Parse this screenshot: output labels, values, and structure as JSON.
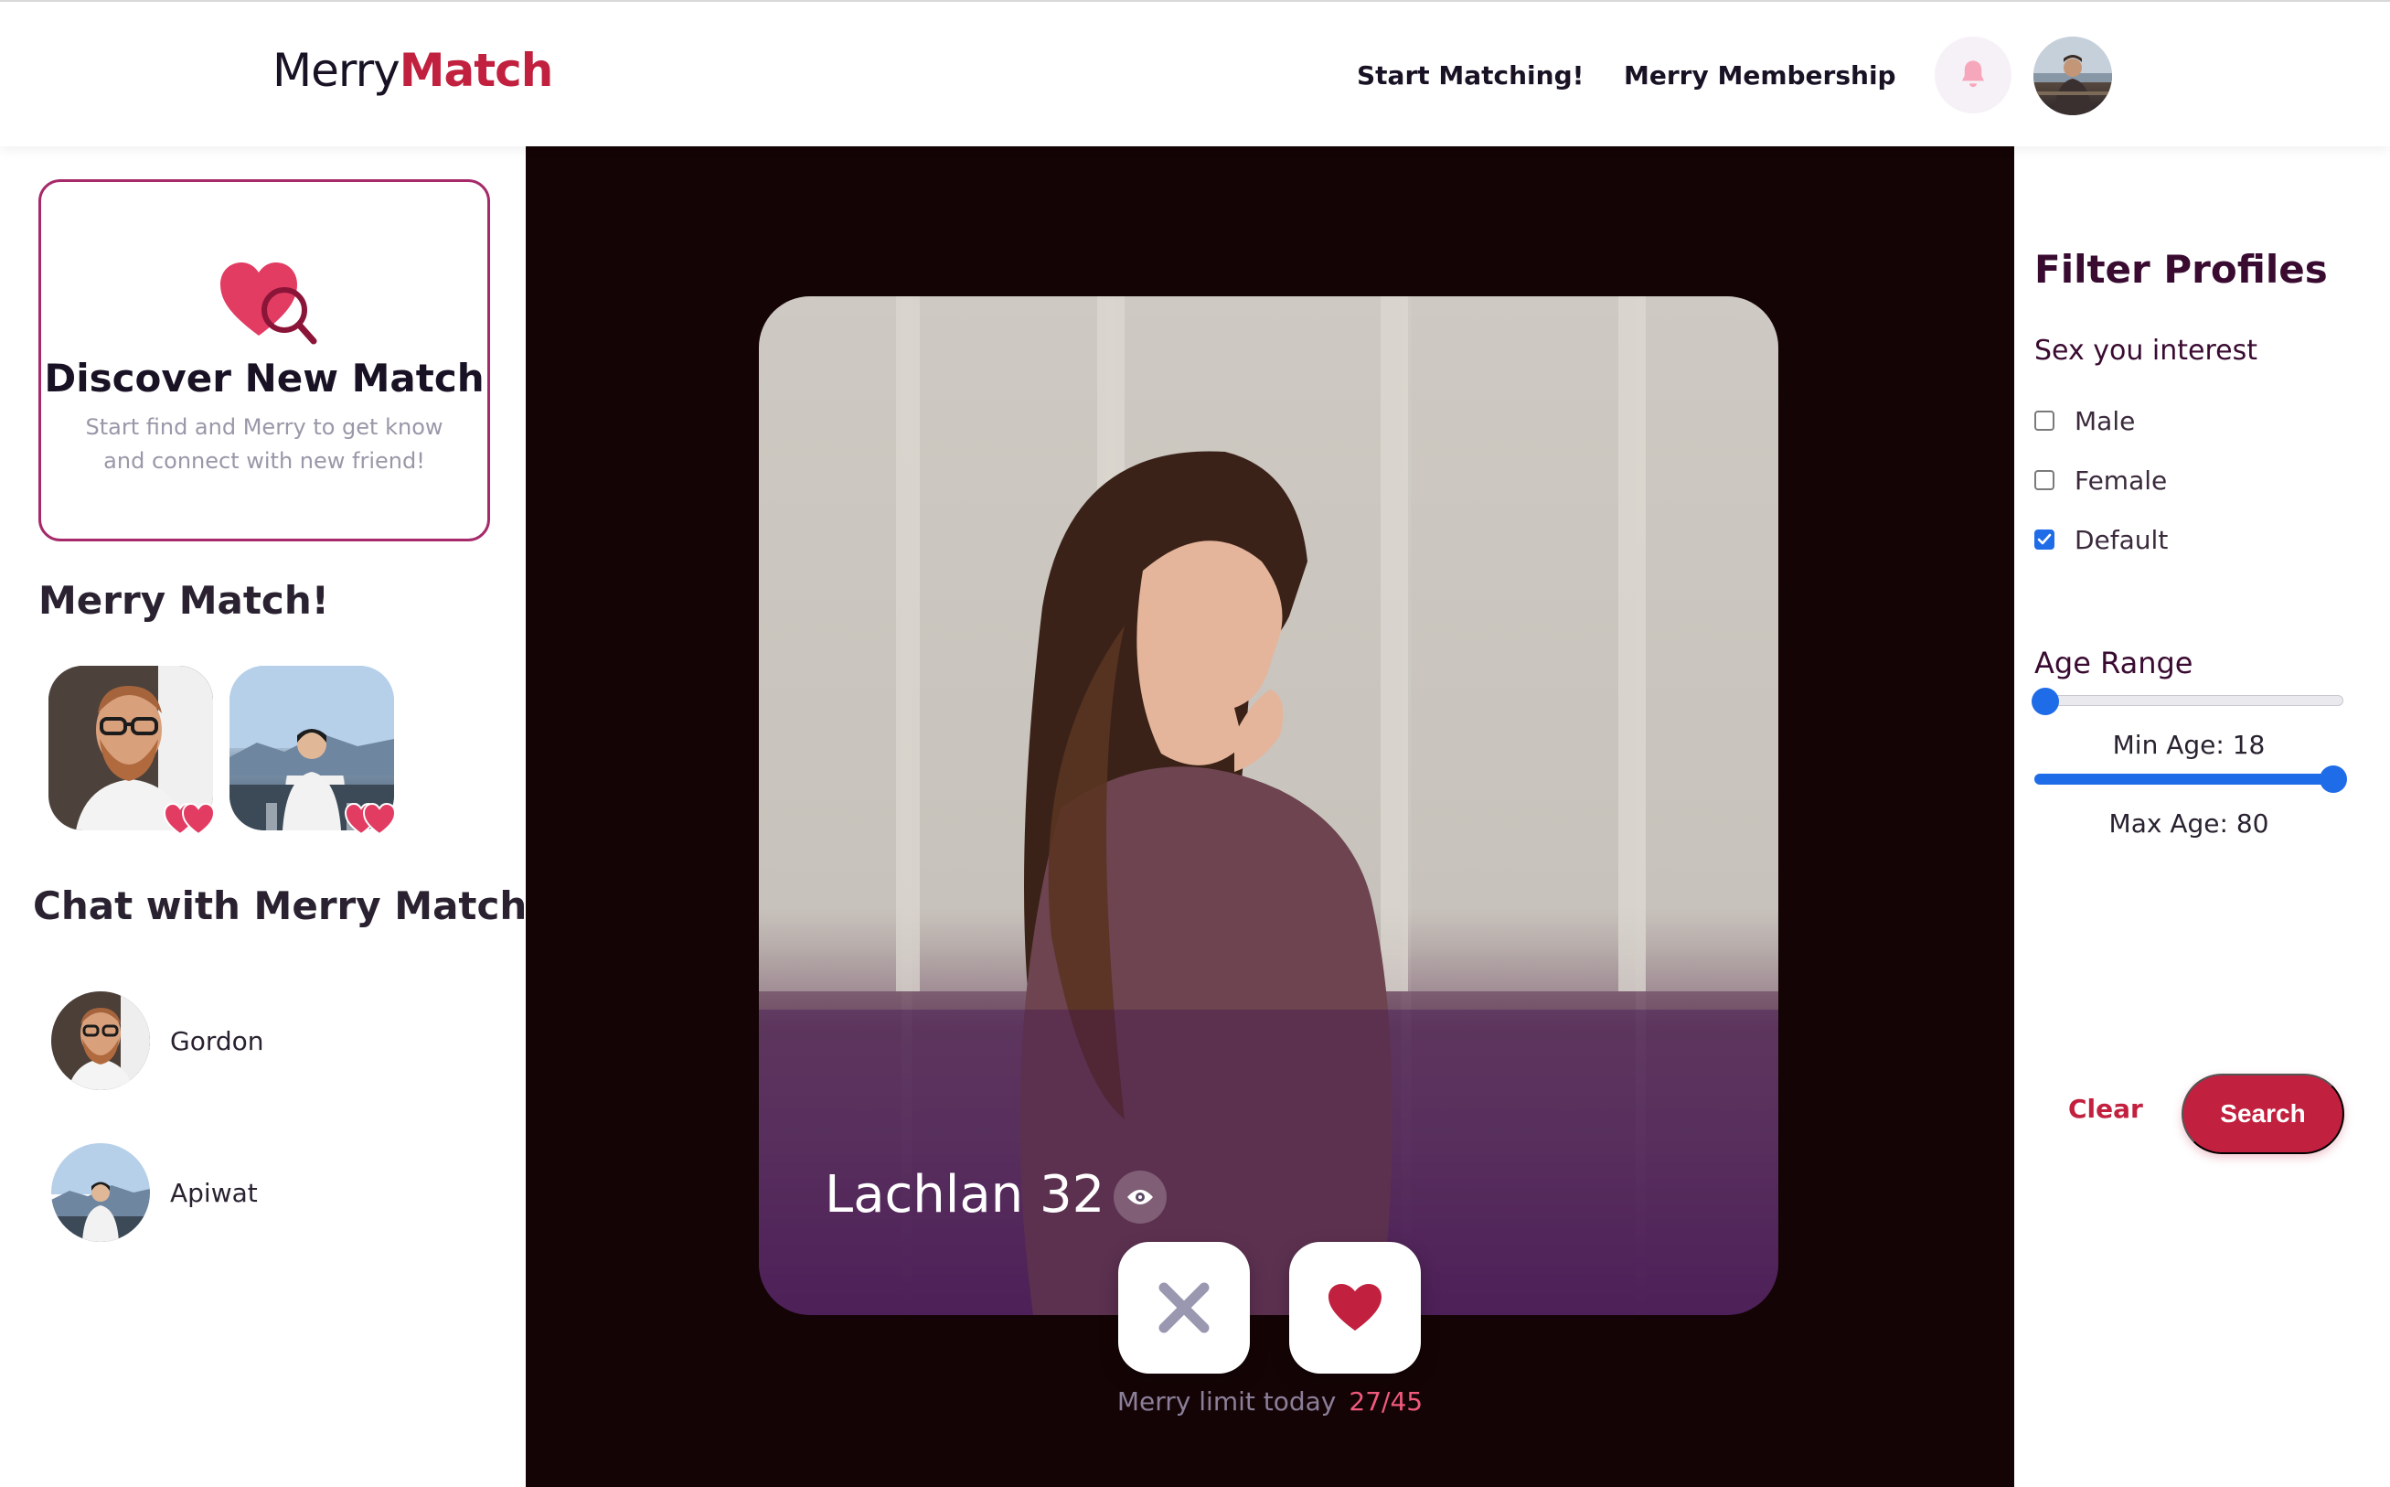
{
  "brand": {
    "logo_part1": "Merry",
    "logo_part2": "Match"
  },
  "nav": {
    "start_matching": "Start Matching!",
    "membership": "Merry Membership",
    "bell_icon": "bell-icon",
    "avatar": "user-avatar"
  },
  "discover": {
    "title": "Discover New Match",
    "subtitle": "Start find and Merry to get know and connect with new friend!",
    "icon": "heart-search-icon"
  },
  "merry_match": {
    "title": "Merry Match!",
    "items": [
      {
        "icon": "double-heart-icon"
      },
      {
        "icon": "double-heart-icon"
      }
    ]
  },
  "chat": {
    "title": "Chat with Merry Match",
    "items": [
      {
        "name": "Gordon"
      },
      {
        "name": "Apiwat"
      }
    ]
  },
  "profile": {
    "name_age": "Lachlan 32",
    "view_icon": "eye-icon"
  },
  "actions": {
    "pass_icon": "close-x-icon",
    "like_icon": "heart-icon",
    "limit_label": "Merry limit today",
    "limit_count": "27/45"
  },
  "filter": {
    "title": "Filter Profiles",
    "sex_label": "Sex you interest",
    "options": [
      {
        "label": "Male",
        "checked": false
      },
      {
        "label": "Female",
        "checked": false
      },
      {
        "label": "Default",
        "checked": true
      }
    ],
    "age_title": "Age Range",
    "min_age_text": "Min Age: 18",
    "max_age_text": "Max Age: 80",
    "min_age": 18,
    "max_age": 80,
    "clear": "Clear",
    "search": "Search"
  },
  "colors": {
    "brand_red": "#c2203f",
    "stage_bg": "#150406",
    "slider_blue": "#1f6ce8",
    "purple_title": "#3a0b31"
  }
}
